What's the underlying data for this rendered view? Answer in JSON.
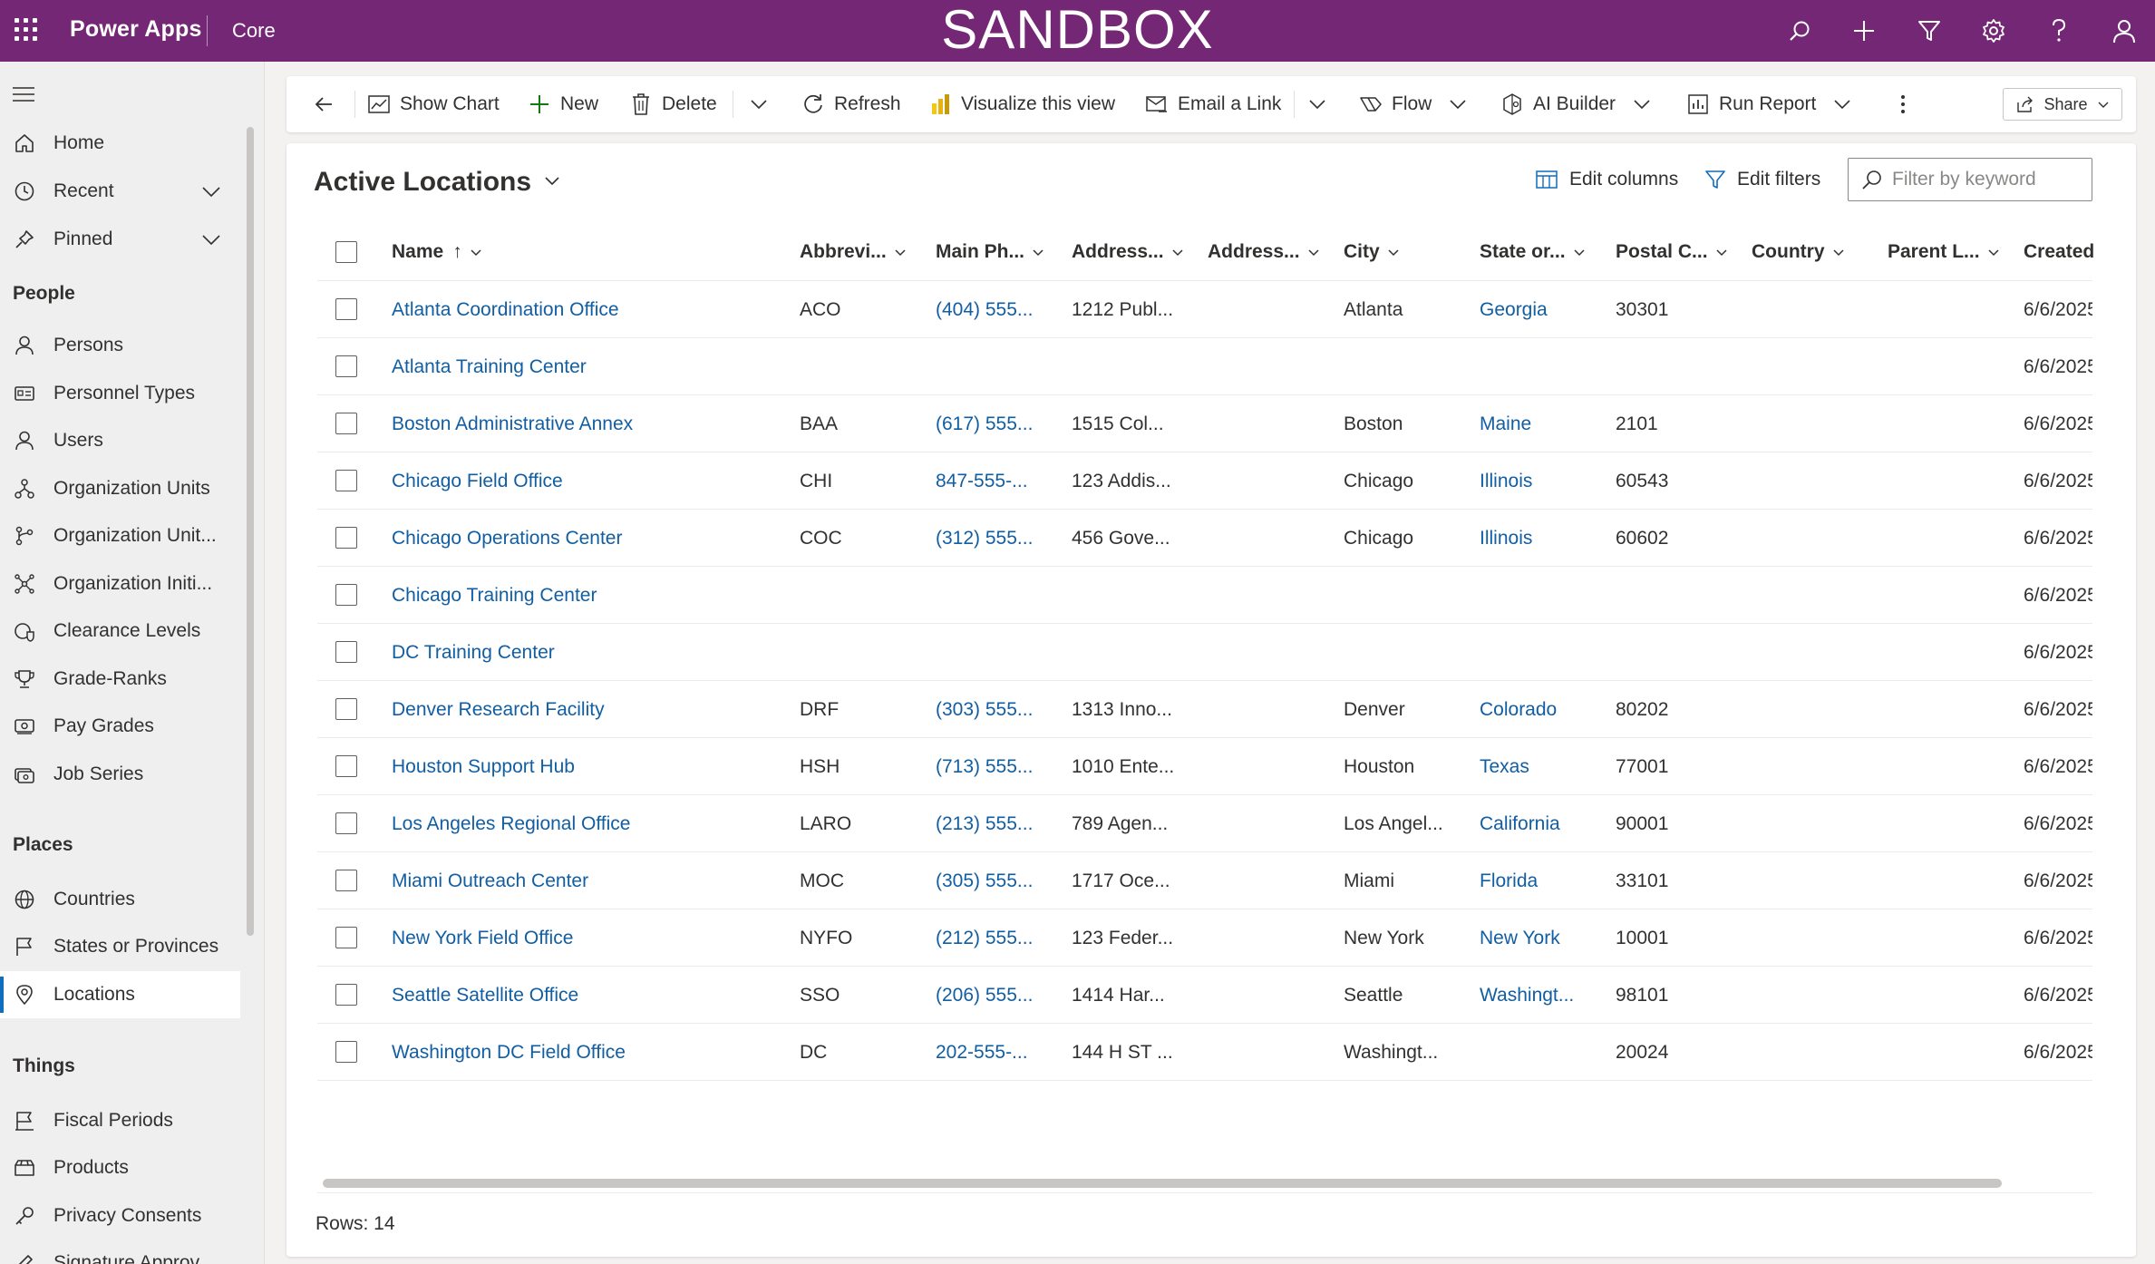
{
  "topbar": {
    "app_name": "Power Apps",
    "environment": "Core",
    "banner": "SANDBOX",
    "icons": [
      "search-icon",
      "add-icon",
      "filter-icon",
      "settings-icon",
      "help-icon",
      "user-icon"
    ]
  },
  "sidebar": {
    "items_top": [
      {
        "label": "Home",
        "icon": "home-icon"
      },
      {
        "label": "Recent",
        "icon": "clock-icon"
      },
      {
        "label": "Pinned",
        "icon": "pin-icon"
      }
    ],
    "groups": [
      {
        "title": "People",
        "items": [
          {
            "label": "Persons"
          },
          {
            "label": "Personnel Types"
          },
          {
            "label": "Users"
          },
          {
            "label": "Organization Units"
          },
          {
            "label": "Organization Unit..."
          },
          {
            "label": "Organization Initi..."
          },
          {
            "label": "Clearance Levels"
          },
          {
            "label": "Grade-Ranks"
          },
          {
            "label": "Pay Grades"
          },
          {
            "label": "Job Series"
          }
        ]
      },
      {
        "title": "Places",
        "items": [
          {
            "label": "Countries"
          },
          {
            "label": "States or Provinces"
          },
          {
            "label": "Locations"
          }
        ]
      },
      {
        "title": "Things",
        "items": [
          {
            "label": "Fiscal Periods"
          },
          {
            "label": "Products"
          },
          {
            "label": "Privacy Consents"
          },
          {
            "label": "Signature Approv..."
          }
        ]
      }
    ]
  },
  "commandbar": {
    "show_chart": "Show Chart",
    "new": "New",
    "delete": "Delete",
    "refresh": "Refresh",
    "visualize": "Visualize this view",
    "email_link": "Email a Link",
    "flow": "Flow",
    "ai_builder": "AI Builder",
    "run_report": "Run Report",
    "share": "Share"
  },
  "view": {
    "title": "Active Locations",
    "edit_columns": "Edit columns",
    "edit_filters": "Edit filters",
    "filter_placeholder": "Filter by keyword",
    "rows_label": "Rows: 14"
  },
  "grid": {
    "columns": [
      "Name",
      "Abbrevi...",
      "Main Ph...",
      "Address...",
      "Address...",
      "City",
      "State or...",
      "Postal C...",
      "Country",
      "Parent L...",
      "Created"
    ],
    "sort_indicator": "↑",
    "rows": [
      {
        "name": "Atlanta Coordination Office",
        "abbr": "ACO",
        "phone": "(404) 555...",
        "addr1": "1212 Publ...",
        "addr2": "",
        "city": "Atlanta",
        "state": "Georgia",
        "postal": "30301",
        "country": "",
        "parent": "",
        "created": "6/6/2025"
      },
      {
        "name": "Atlanta Training Center",
        "abbr": "",
        "phone": "",
        "addr1": "",
        "addr2": "",
        "city": "",
        "state": "",
        "postal": "",
        "country": "",
        "parent": "",
        "created": "6/6/2025"
      },
      {
        "name": "Boston Administrative Annex",
        "abbr": "BAA",
        "phone": "(617) 555...",
        "addr1": "1515 Col...",
        "addr2": "",
        "city": "Boston",
        "state": "Maine",
        "postal": "2101",
        "country": "",
        "parent": "",
        "created": "6/6/2025"
      },
      {
        "name": "Chicago Field Office",
        "abbr": "CHI",
        "phone": "847-555-...",
        "addr1": "123 Addis...",
        "addr2": "",
        "city": "Chicago",
        "state": "Illinois",
        "postal": "60543",
        "country": "",
        "parent": "",
        "created": "6/6/2025"
      },
      {
        "name": "Chicago Operations Center",
        "abbr": "COC",
        "phone": "(312) 555...",
        "addr1": "456 Gove...",
        "addr2": "",
        "city": "Chicago",
        "state": "Illinois",
        "postal": "60602",
        "country": "",
        "parent": "",
        "created": "6/6/2025"
      },
      {
        "name": "Chicago Training Center",
        "abbr": "",
        "phone": "",
        "addr1": "",
        "addr2": "",
        "city": "",
        "state": "",
        "postal": "",
        "country": "",
        "parent": "",
        "created": "6/6/2025"
      },
      {
        "name": "DC Training Center",
        "abbr": "",
        "phone": "",
        "addr1": "",
        "addr2": "",
        "city": "",
        "state": "",
        "postal": "",
        "country": "",
        "parent": "",
        "created": "6/6/2025"
      },
      {
        "name": "Denver Research Facility",
        "abbr": "DRF",
        "phone": "(303) 555...",
        "addr1": "1313 Inno...",
        "addr2": "",
        "city": "Denver",
        "state": "Colorado",
        "postal": "80202",
        "country": "",
        "parent": "",
        "created": "6/6/2025"
      },
      {
        "name": "Houston Support Hub",
        "abbr": "HSH",
        "phone": "(713) 555...",
        "addr1": "1010 Ente...",
        "addr2": "",
        "city": "Houston",
        "state": "Texas",
        "postal": "77001",
        "country": "",
        "parent": "",
        "created": "6/6/2025"
      },
      {
        "name": "Los Angeles Regional Office",
        "abbr": "LARO",
        "phone": "(213) 555...",
        "addr1": "789 Agen...",
        "addr2": "",
        "city": "Los Angel...",
        "state": "California",
        "postal": "90001",
        "country": "",
        "parent": "",
        "created": "6/6/2025"
      },
      {
        "name": "Miami Outreach Center",
        "abbr": "MOC",
        "phone": "(305) 555...",
        "addr1": "1717 Oce...",
        "addr2": "",
        "city": "Miami",
        "state": "Florida",
        "postal": "33101",
        "country": "",
        "parent": "",
        "created": "6/6/2025"
      },
      {
        "name": "New York Field Office",
        "abbr": "NYFO",
        "phone": "(212) 555...",
        "addr1": "123 Feder...",
        "addr2": "",
        "city": "New York",
        "state": "New York",
        "postal": "10001",
        "country": "",
        "parent": "",
        "created": "6/6/2025"
      },
      {
        "name": "Seattle Satellite Office",
        "abbr": "SSO",
        "phone": "(206) 555...",
        "addr1": "1414 Har...",
        "addr2": "",
        "city": "Seattle",
        "state": "Washingt...",
        "postal": "98101",
        "country": "",
        "parent": "",
        "created": "6/6/2025"
      },
      {
        "name": "Washington DC Field Office",
        "abbr": "DC",
        "phone": "202-555-...",
        "addr1": "144 H ST ...",
        "addr2": "",
        "city": "Washingt...",
        "state": "",
        "postal": "20024",
        "country": "",
        "parent": "",
        "created": "6/6/2025"
      }
    ]
  },
  "colors": {
    "topbar": "#742774",
    "link": "#115ea3",
    "active_indicator": "#106ebe"
  }
}
